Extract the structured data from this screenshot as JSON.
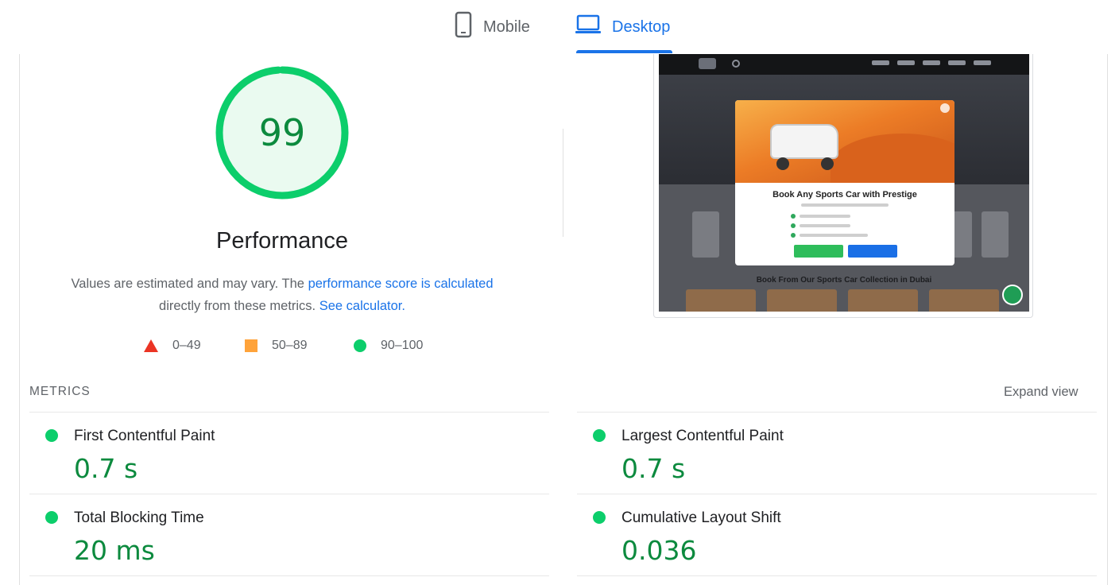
{
  "tabs": [
    {
      "label": "Mobile",
      "icon": "phone-icon",
      "active": false
    },
    {
      "label": "Desktop",
      "icon": "laptop-icon",
      "active": true
    }
  ],
  "performance": {
    "score": "99",
    "score_fraction": 0.99,
    "title": "Performance",
    "desc_prefix": "Values are estimated and may vary. The ",
    "desc_link": "performance score is calculated",
    "desc_middle": "directly from these metrics. ",
    "calc_link": "See calculator."
  },
  "legend": [
    {
      "shape": "triangle",
      "color": "#eb3424",
      "label": "0–49"
    },
    {
      "shape": "square",
      "color": "#ffa33a",
      "label": "50–89"
    },
    {
      "shape": "circle",
      "color": "#0cce6b",
      "label": "90–100"
    }
  ],
  "preview": {
    "modal_title": "Book Any Sports Car with Prestige",
    "lower_title": "Book From Our Sports Car Collection in Dubai"
  },
  "metrics": {
    "header": "METRICS",
    "expand_label": "Expand view",
    "items": [
      {
        "name": "First Contentful Paint",
        "value": "0.7 s"
      },
      {
        "name": "Largest Contentful Paint",
        "value": "0.7 s"
      },
      {
        "name": "Total Blocking Time",
        "value": "20 ms"
      },
      {
        "name": "Cumulative Layout Shift",
        "value": "0.036"
      }
    ]
  },
  "colors": {
    "accent": "#1a73e8",
    "pass": "#0cce6b",
    "pass_text": "#0c8a3e",
    "average": "#ffa33a",
    "fail": "#eb3424"
  }
}
